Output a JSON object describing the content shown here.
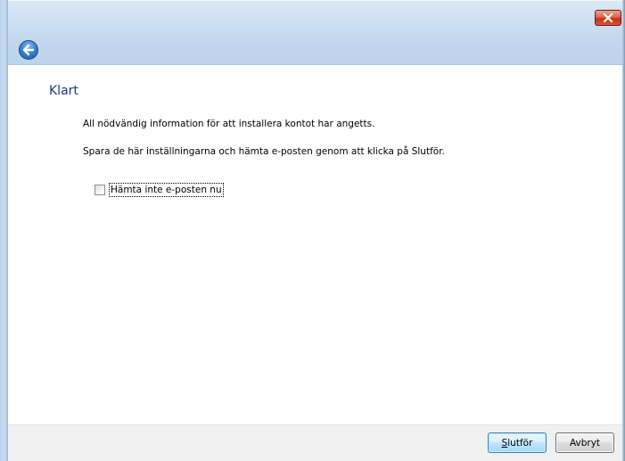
{
  "window": {
    "close_icon": "close-x-icon",
    "back_icon": "back-arrow-icon"
  },
  "page": {
    "title": "Klart",
    "info_line_1": "All nödvändig information för att installera kontot har angetts.",
    "info_line_2": "Spara de här inställningarna och hämta e-posten genom att klicka på Slutför."
  },
  "options": {
    "dont_fetch_label": "Hämta inte e-posten nu",
    "dont_fetch_checked": false
  },
  "footer": {
    "finish_mnemonic": "S",
    "finish_rest": "lutför",
    "cancel_label": "Avbryt"
  },
  "colors": {
    "title_text": "#1e3287",
    "close_button": "#c7301a",
    "back_button": "#3d83d0",
    "footer_bg": "#f0f0f0"
  }
}
